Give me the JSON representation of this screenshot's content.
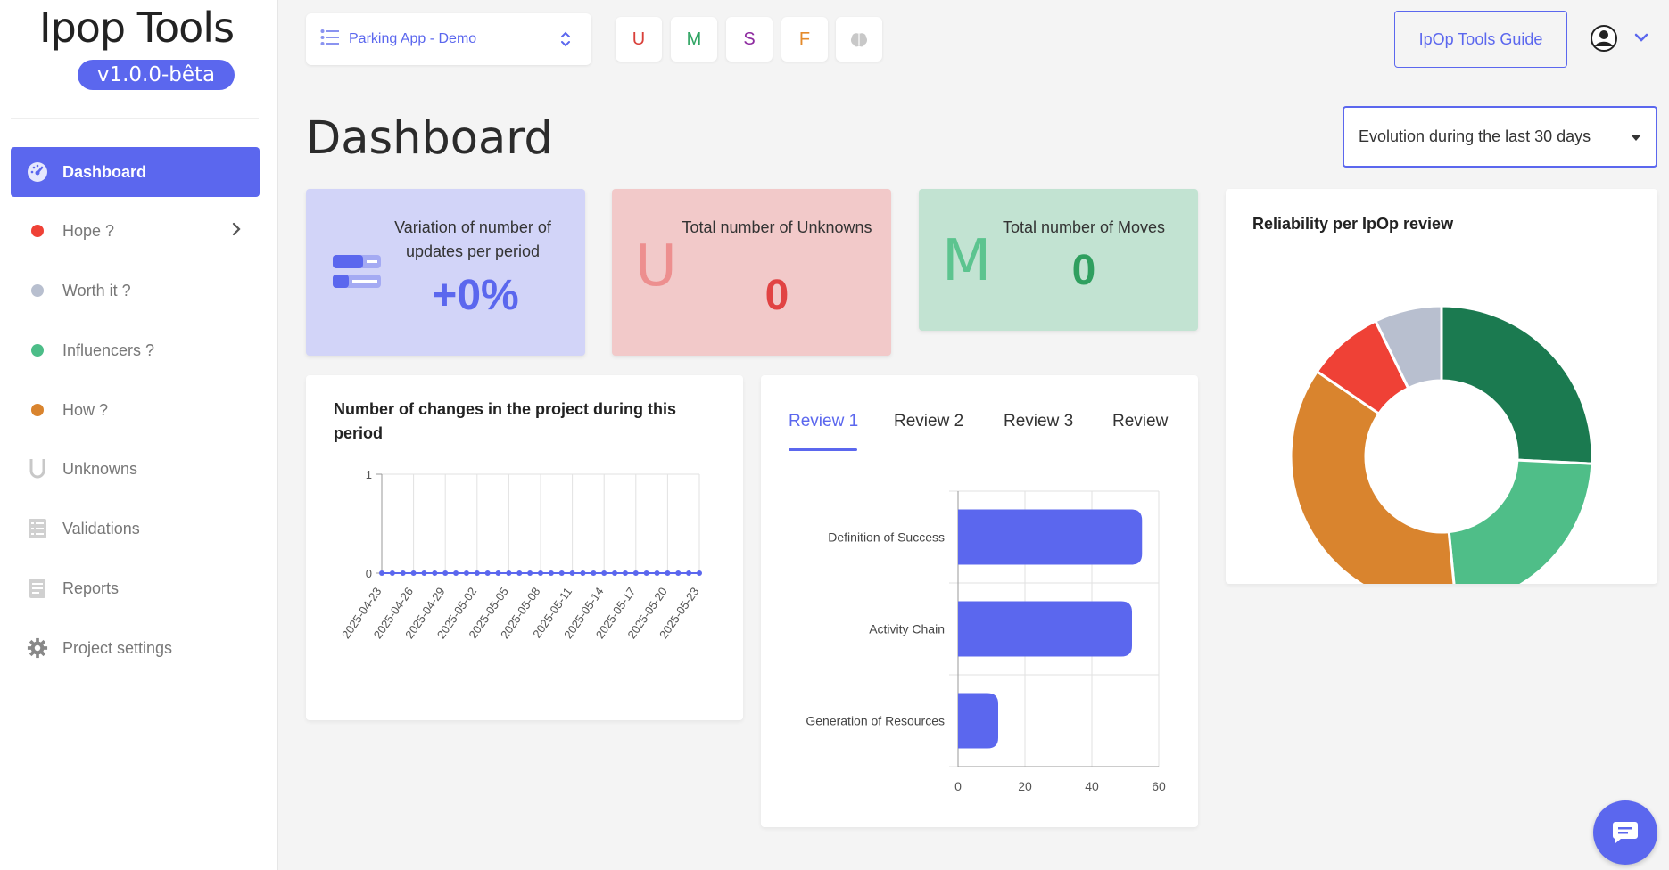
{
  "app": {
    "title": "Ipop Tools",
    "version": "v1.0.0-bêta"
  },
  "sidebar": {
    "items": [
      {
        "label": "Dashboard",
        "icon": "dashboard-gauge-icon",
        "active": true
      },
      {
        "label": "Hope ?",
        "icon": "red-dot-icon",
        "color": "#ef4136"
      },
      {
        "label": "Worth it ?",
        "icon": "gray-dot-icon",
        "color": "#b8bfcf"
      },
      {
        "label": "Influencers ?",
        "icon": "green-dot-icon",
        "color": "#4cbd88"
      },
      {
        "label": "How ?",
        "icon": "orange-dot-icon",
        "color": "#d9842e"
      },
      {
        "label": "Unknowns",
        "icon": "u-letter-icon"
      },
      {
        "label": "Validations",
        "icon": "checklist-icon"
      },
      {
        "label": "Reports",
        "icon": "document-icon"
      },
      {
        "label": "Project settings",
        "icon": "gear-icon"
      }
    ]
  },
  "topbar": {
    "project": "Parking App - Demo",
    "filters": [
      {
        "label": "U",
        "color": "#d9403a"
      },
      {
        "label": "M",
        "color": "#2fa463"
      },
      {
        "label": "S",
        "color": "#8e2ba0"
      },
      {
        "label": "F",
        "color": "#e48a2a"
      }
    ],
    "guide_label": "IpOp Tools Guide"
  },
  "page": {
    "title": "Dashboard",
    "period": "Evolution during the last 30 days"
  },
  "stats": [
    {
      "label": "Variation of number of updates per period",
      "value": "+0%",
      "color": "#5b67ee",
      "bg": "#d2d4f8"
    },
    {
      "label": "Total number of Unknowns",
      "value": "0",
      "letter": "U",
      "color": "#e14343",
      "bg": "#f2c9c9"
    },
    {
      "label": "Total number of Moves",
      "value": "0",
      "letter": "M",
      "color": "#2f9f5f",
      "bg": "#c2e3d2"
    }
  ],
  "changes_chart": {
    "title": "Number of changes in the project during this period"
  },
  "reviews": {
    "tabs": [
      "Review 1",
      "Review 2",
      "Review 3",
      "Review"
    ]
  },
  "reliability": {
    "title": "Reliability per IpOp review"
  },
  "chart_data": [
    {
      "type": "line",
      "title": "Number of changes in the project during this period",
      "x": [
        "2025-04-23",
        "2025-04-24",
        "2025-04-25",
        "2025-04-26",
        "2025-04-27",
        "2025-04-28",
        "2025-04-29",
        "2025-04-30",
        "2025-05-01",
        "2025-05-02",
        "2025-05-03",
        "2025-05-04",
        "2025-05-05",
        "2025-05-06",
        "2025-05-07",
        "2025-05-08",
        "2025-05-09",
        "2025-05-10",
        "2025-05-11",
        "2025-05-12",
        "2025-05-13",
        "2025-05-14",
        "2025-05-15",
        "2025-05-16",
        "2025-05-17",
        "2025-05-18",
        "2025-05-19",
        "2025-05-20",
        "2025-05-21",
        "2025-05-22",
        "2025-05-23"
      ],
      "x_tick_labels": [
        "2025-04-23",
        "2025-04-26",
        "2025-04-29",
        "2025-05-02",
        "2025-05-05",
        "2025-05-08",
        "2025-05-11",
        "2025-05-14",
        "2025-05-17",
        "2025-05-20",
        "2025-05-23"
      ],
      "values": [
        0,
        0,
        0,
        0,
        0,
        0,
        0,
        0,
        0,
        0,
        0,
        0,
        0,
        0,
        0,
        0,
        0,
        0,
        0,
        0,
        0,
        0,
        0,
        0,
        0,
        0,
        0,
        0,
        0,
        0,
        0
      ],
      "ylim": [
        0,
        1
      ],
      "y_ticks": [
        0,
        1
      ],
      "color": "#5b67ee",
      "grid": true
    },
    {
      "type": "bar",
      "orientation": "horizontal",
      "categories": [
        "Definition of Success",
        "Activity Chain",
        "Generation of Resources"
      ],
      "values": [
        55,
        52,
        12
      ],
      "xlim": [
        0,
        60
      ],
      "x_ticks": [
        0,
        20,
        40,
        60
      ],
      "color": "#5b67ee",
      "grid": true
    },
    {
      "type": "pie",
      "title": "Reliability per IpOp review",
      "donut": true,
      "values": [
        25,
        22,
        35,
        8,
        7
      ],
      "colors": [
        "#1b7a50",
        "#4fbe88",
        "#d9842e",
        "#ef4136",
        "#b8bfcf"
      ]
    }
  ]
}
